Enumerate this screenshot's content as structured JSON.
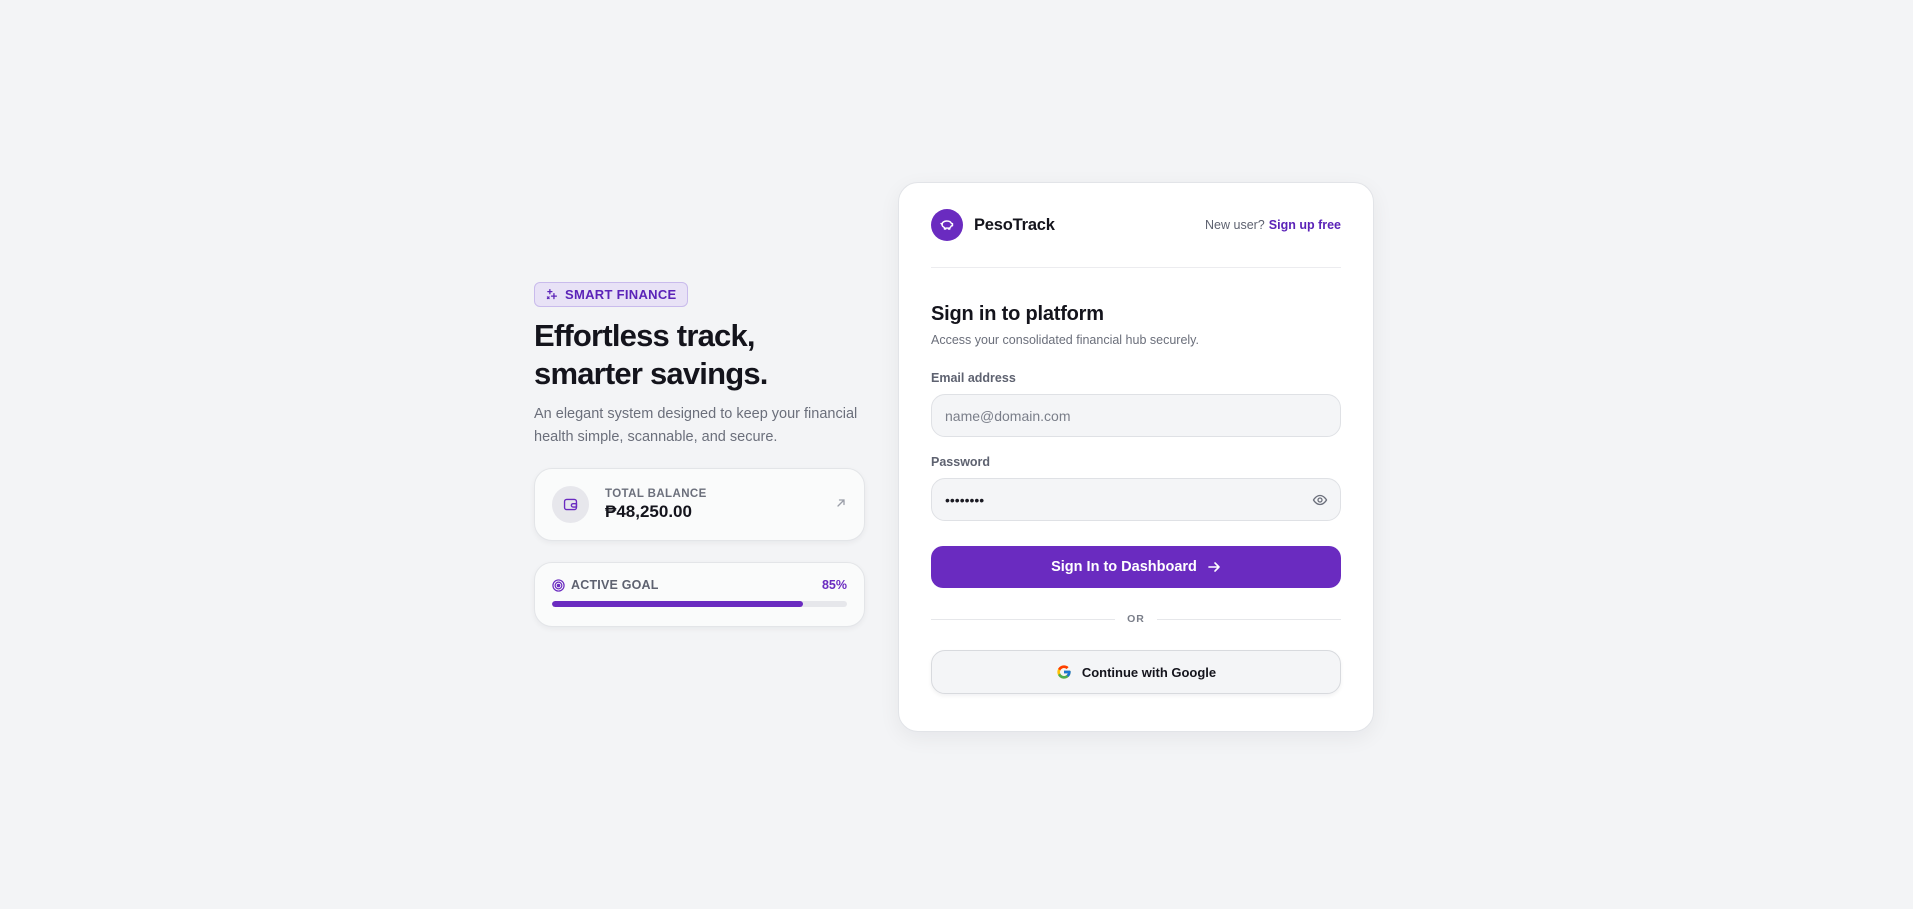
{
  "hero": {
    "badge": "SMART FINANCE",
    "headline_line1": "Effortless track,",
    "headline_line2": "smarter savings.",
    "subtext": "An elegant system designed to keep your financial health simple, scannable, and secure."
  },
  "balance_card": {
    "label": "TOTAL BALANCE",
    "value": "₱48,250.00",
    "icon": "wallet-icon"
  },
  "goal_card": {
    "label": "ACTIVE GOAL",
    "percent_text": "85%",
    "progress": 0.85,
    "icon": "target-icon"
  },
  "signin": {
    "brand": "PesoTrack",
    "new_user_text": "New user?",
    "signup_link": "Sign up free",
    "title": "Sign in to platform",
    "description": "Access your consolidated financial hub securely.",
    "email_label": "Email address",
    "email_placeholder": "name@domain.com",
    "email_value": "",
    "password_label": "Password",
    "password_value": "password",
    "primary_button": "Sign In to Dashboard",
    "divider_text": "OR",
    "google_button": "Continue with Google"
  },
  "colors": {
    "accent": "#6a2bc0",
    "background": "#f3f4f6",
    "badge_bg": "#e8e2f6"
  }
}
